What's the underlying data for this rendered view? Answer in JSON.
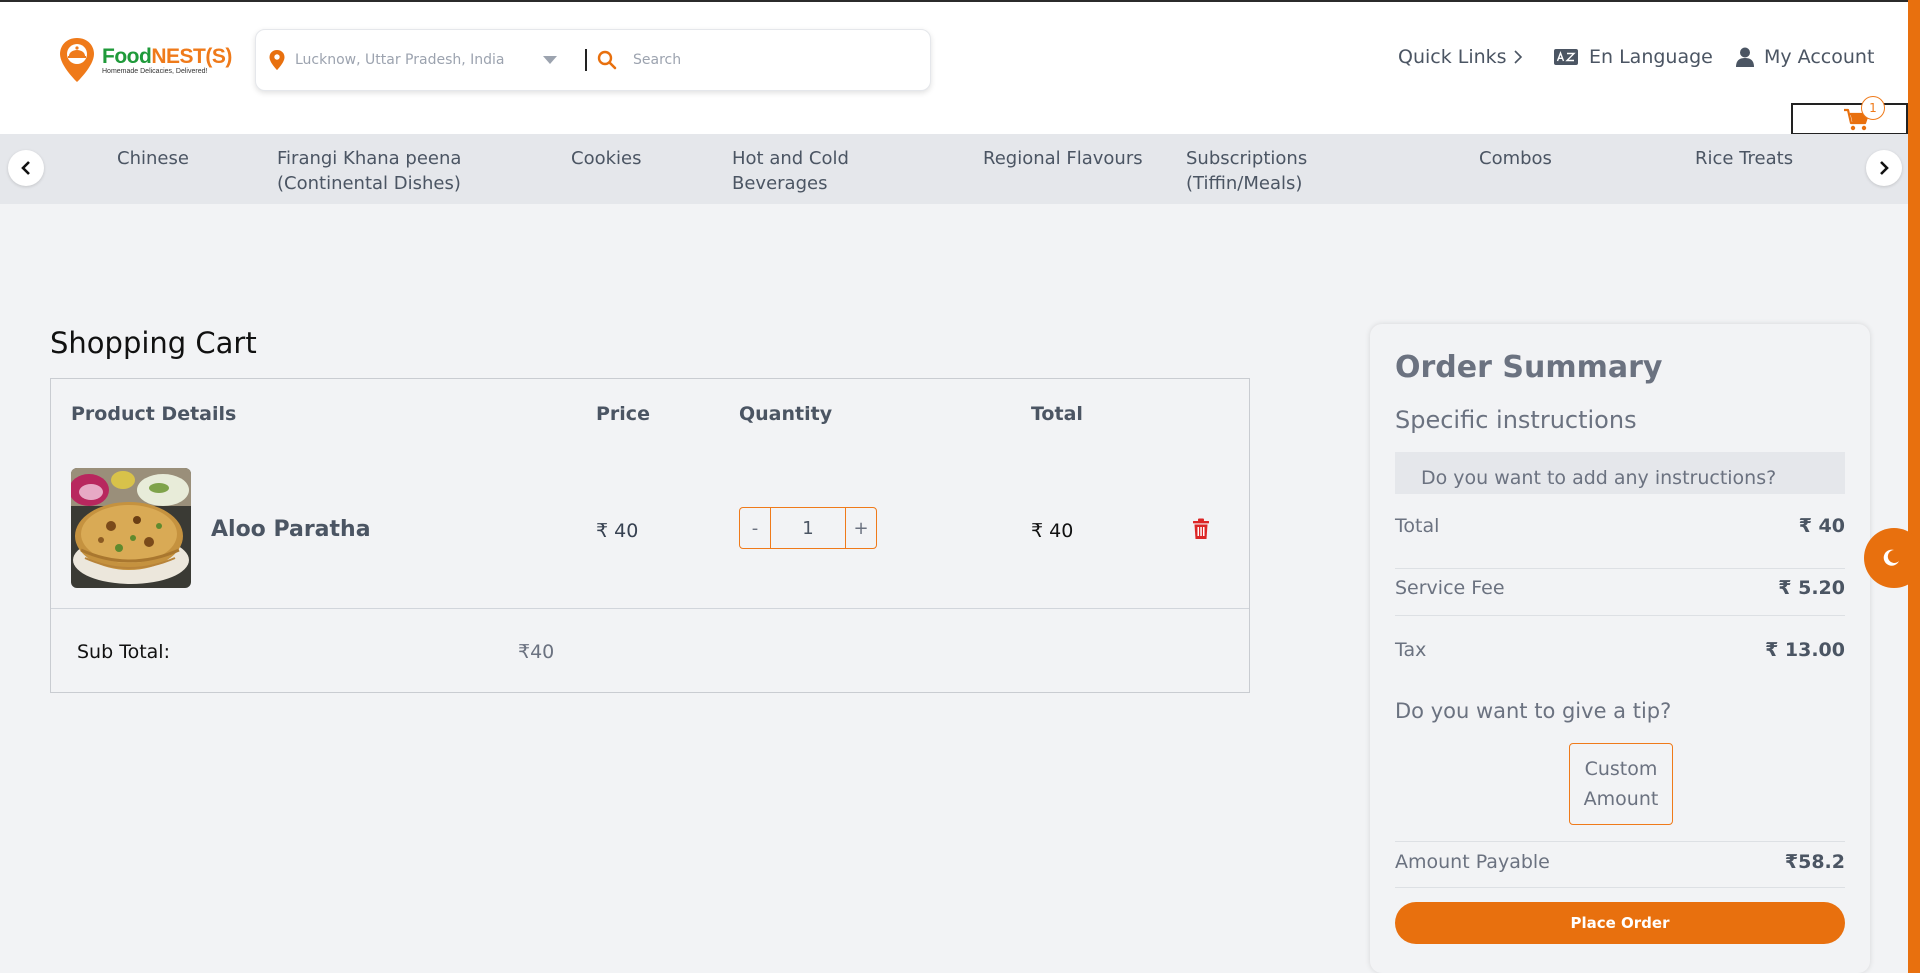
{
  "brand": {
    "name_part1": "Food",
    "name_part2": "NEST(S)",
    "tagline": "Homemade Delicacies, Delivered!"
  },
  "search": {
    "location": "Lucknow, Uttar Pradesh, India",
    "placeholder": "Search"
  },
  "topnav": {
    "quick_links": "Quick Links",
    "language": "En Language",
    "account": "My Account"
  },
  "cart_badge": "1",
  "categories": [
    {
      "line1": "Chinese",
      "line2": ""
    },
    {
      "line1": "Firangi Khana peena",
      "line2": "(Continental Dishes)"
    },
    {
      "line1": "Cookies",
      "line2": ""
    },
    {
      "line1": "Hot and Cold",
      "line2": "Beverages"
    },
    {
      "line1": "Regional Flavours",
      "line2": ""
    },
    {
      "line1": "Subscriptions",
      "line2": "(Tiffin/Meals)"
    },
    {
      "line1": "Combos",
      "line2": ""
    },
    {
      "line1": "Rice Treats",
      "line2": ""
    }
  ],
  "cart": {
    "title": "Shopping Cart",
    "headers": {
      "product": "Product Details",
      "price": "Price",
      "quantity": "Quantity",
      "total": "Total"
    },
    "items": [
      {
        "name": "Aloo Paratha",
        "price": "₹ 40",
        "quantity": "1",
        "total": "₹ 40"
      }
    ],
    "qty_minus": "-",
    "qty_plus": "+",
    "subtotal_label": "Sub Total:",
    "subtotal_value": "₹40"
  },
  "summary": {
    "title": "Order Summary",
    "instructions_heading": "Specific instructions",
    "instructions_placeholder": "Do you want to add any instructions?",
    "rows": [
      {
        "label": "Total",
        "value": "₹ 40"
      },
      {
        "label": "Service Fee",
        "value": "₹ 5.20"
      },
      {
        "label": "Tax",
        "value": "₹ 13.00"
      }
    ],
    "tip_question": "Do you want to give a tip?",
    "tip_custom_line1": "Custom",
    "tip_custom_line2": "Amount",
    "payable_label": "Amount Payable",
    "payable_value": "₹58.2",
    "place_order": "Place Order"
  },
  "colors": {
    "accent": "#e8700e",
    "brand_green": "#1f9a3a",
    "delete_red": "#dc2626"
  },
  "icons": [
    "location-pin-icon",
    "caret-down-icon",
    "search-icon",
    "chevron-right-icon",
    "language-icon",
    "user-icon",
    "cart-icon",
    "chevron-left-icon",
    "trash-icon",
    "moon-icon"
  ]
}
